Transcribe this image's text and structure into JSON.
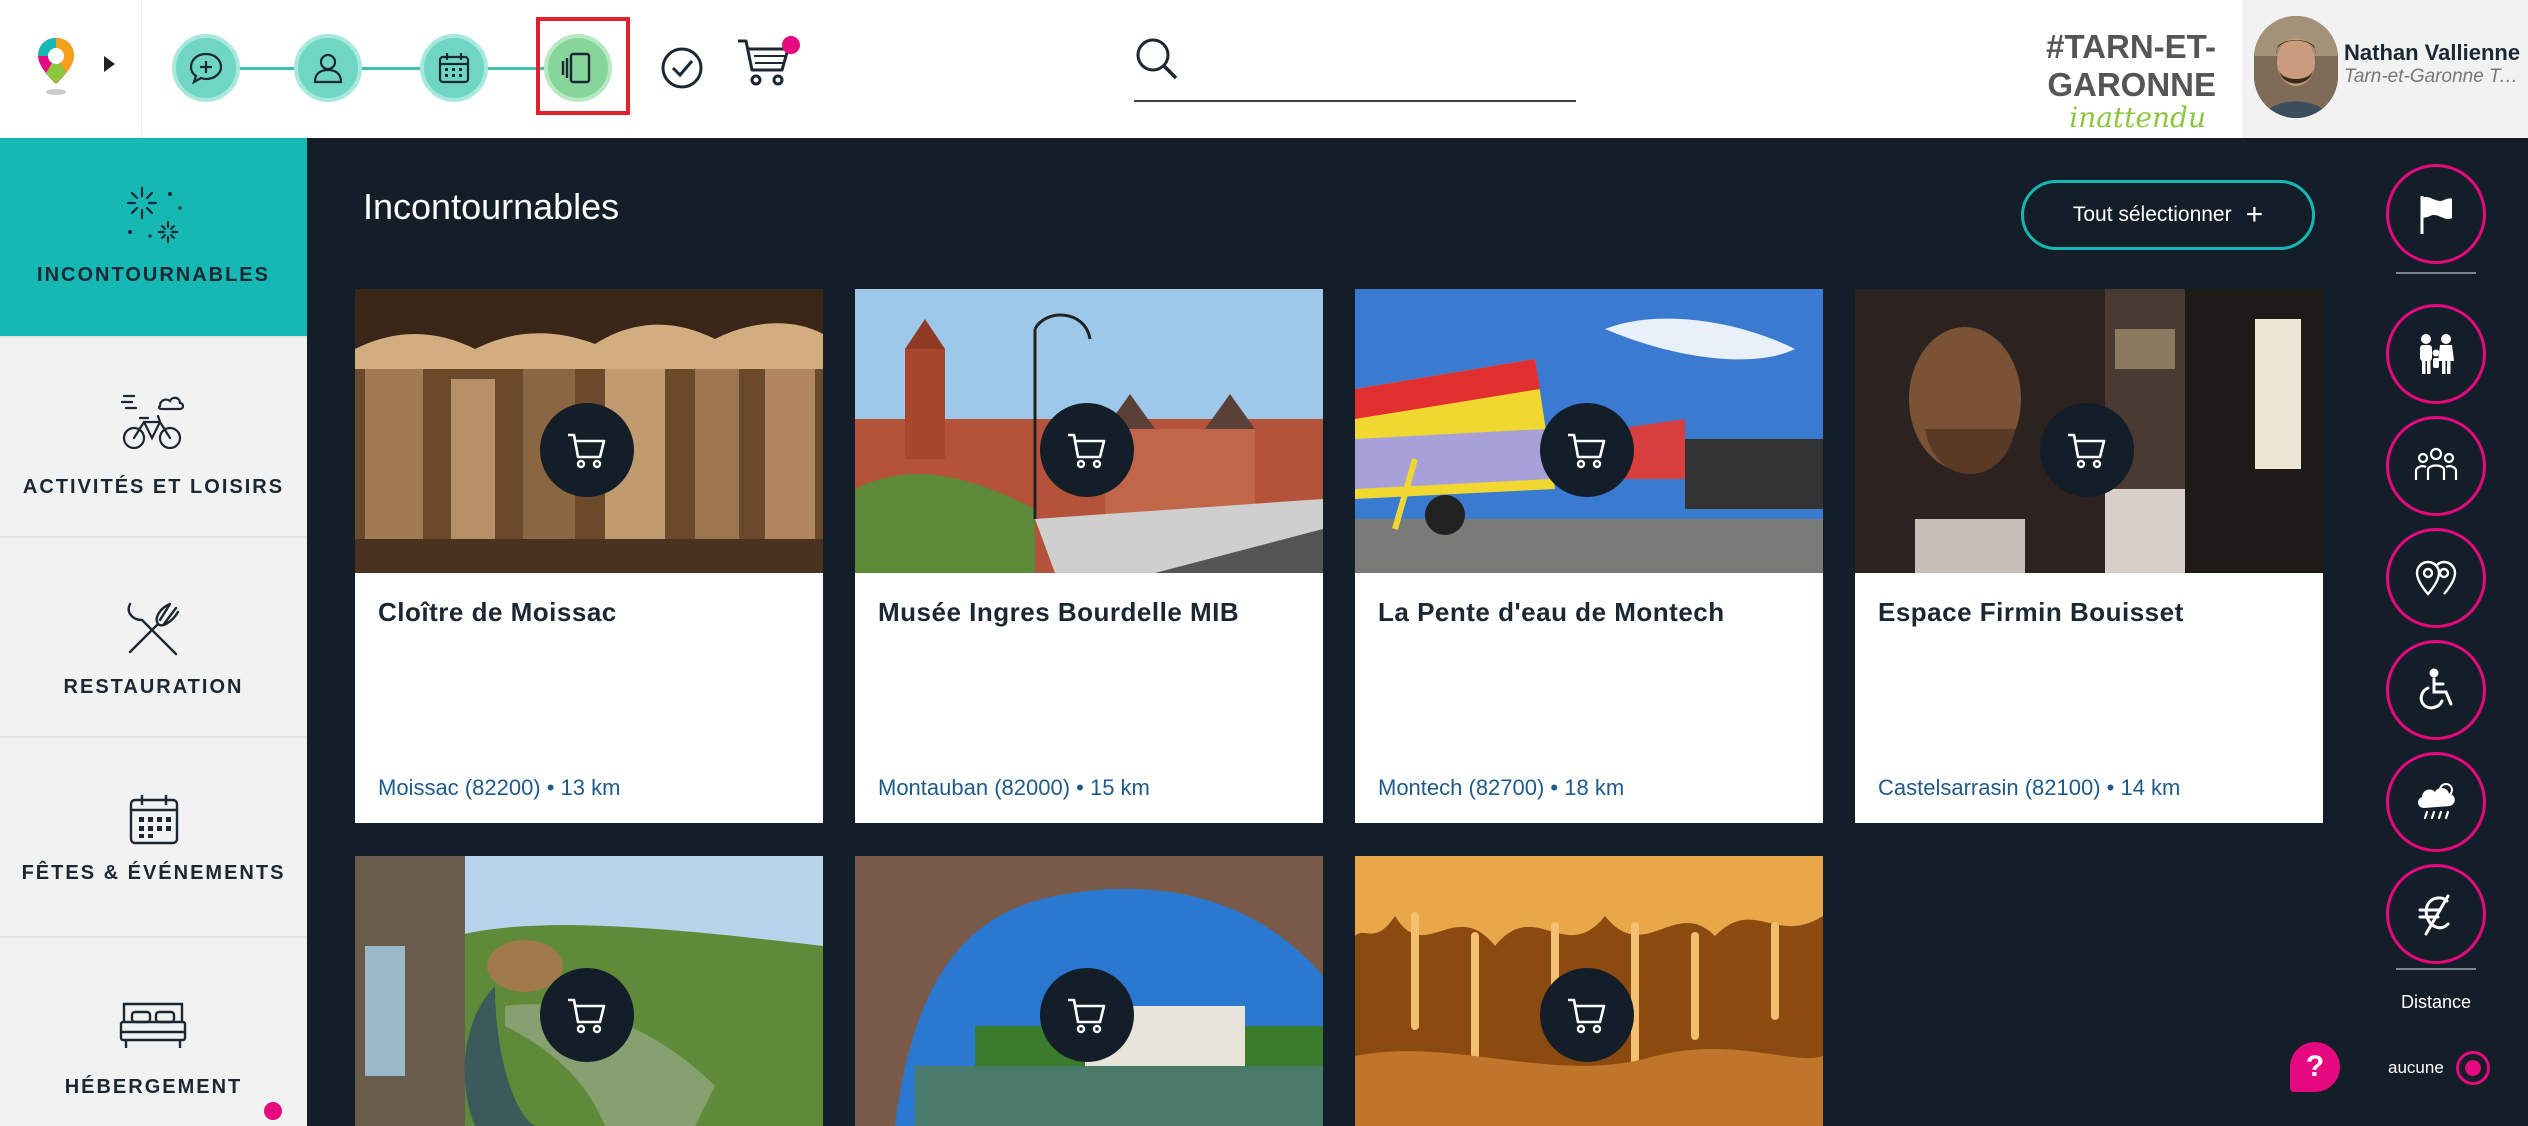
{
  "header": {
    "brand_main": "#TARN-ET-GARONNE",
    "brand_sub": "inattendu",
    "search": {
      "value": "",
      "placeholder": ""
    },
    "user": {
      "name": "Nathan Vallienne",
      "org": "Tarn-et-Garonne Tourisme"
    },
    "stepper": [
      "chat-icon",
      "user-icon",
      "calendar-icon",
      "swipe-cards-icon"
    ],
    "accent_color": "#16b8b4",
    "highlight_color": "#e5087e"
  },
  "sidebar": {
    "items": [
      {
        "label": "INCONTOURNABLES",
        "icon": "fireworks-icon",
        "active": true
      },
      {
        "label": "ACTIVITÉS ET LOISIRS",
        "icon": "bicycle-icon",
        "active": false
      },
      {
        "label": "RESTAURATION",
        "icon": "fork-knife-icon",
        "active": false
      },
      {
        "label": "FÊTES & ÉVÉNEMENTS",
        "icon": "calendar-icon",
        "active": false
      },
      {
        "label": "HÉBERGEMENT",
        "icon": "bed-icon",
        "active": false
      }
    ]
  },
  "main": {
    "title": "Incontournables",
    "select_all_label": "Tout sélectionner",
    "cards": [
      {
        "title": "Cloître de Moissac",
        "location": "Moissac (82200) • 13 km"
      },
      {
        "title": "Musée Ingres Bourdelle MIB",
        "location": "Montauban (82000) • 15 km"
      },
      {
        "title": "La Pente d'eau de Montech",
        "location": "Montech (82700) • 18 km"
      },
      {
        "title": "Espace Firmin Bouisset",
        "location": "Castelsarrasin (82100) • 14 km"
      },
      {
        "title": "",
        "location": ""
      },
      {
        "title": "",
        "location": ""
      },
      {
        "title": "",
        "location": ""
      }
    ]
  },
  "filters": {
    "icons": [
      "flag-icon",
      "family-icon",
      "group-icon",
      "places-icon",
      "wheelchair-icon",
      "weather-icon",
      "no-euro-icon"
    ],
    "distance_label": "Distance",
    "distance_value": "aucune"
  },
  "help": {
    "label": "?"
  }
}
